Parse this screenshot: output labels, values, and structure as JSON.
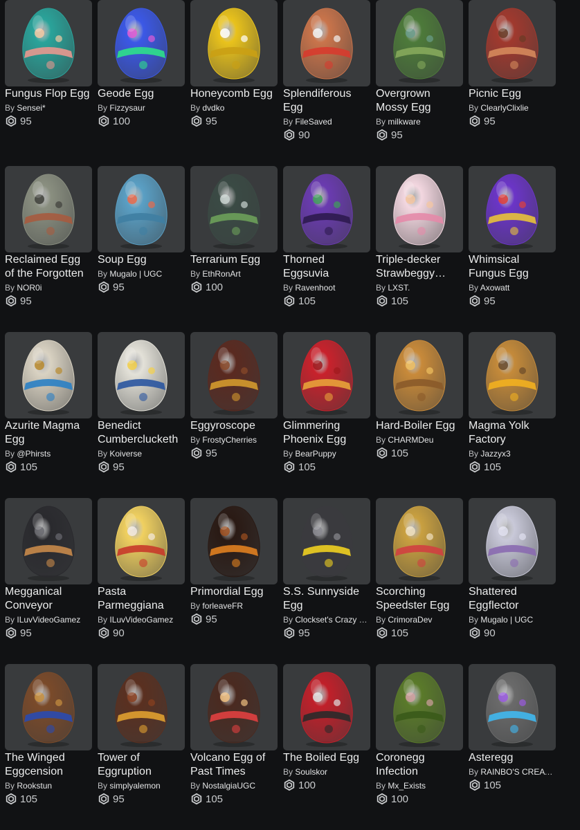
{
  "catalog": {
    "items": [
      {
        "name": "Fungus Flop Egg",
        "by": "By",
        "creator": "Sensei*",
        "price": "95",
        "icon": "mushroom-egg-icon"
      },
      {
        "name": "Geode Egg",
        "by": "By",
        "creator": "Fizzysaur",
        "price": "100",
        "icon": "crystal-egg-icon"
      },
      {
        "name": "Honeycomb Egg",
        "by": "By",
        "creator": "dvdko",
        "price": "95",
        "icon": "honeycomb-egg-icon"
      },
      {
        "name": "Splendiferous Egg",
        "by": "By",
        "creator": "FileSaved",
        "price": "90",
        "icon": "top-hat-egg-icon"
      },
      {
        "name": "Overgrown Mossy Egg",
        "by": "By",
        "creator": "milkware",
        "price": "95",
        "icon": "mossy-egg-icon"
      },
      {
        "name": "Picnic Egg",
        "by": "By",
        "creator": "ClearlyClixlie",
        "price": "95",
        "icon": "picnic-basket-egg-icon"
      },
      {
        "name": "Reclaimed Egg of the Forgotten",
        "by": "By",
        "creator": "NOR0i",
        "price": "95",
        "icon": "ruined-egg-icon"
      },
      {
        "name": "Soup Egg",
        "by": "By",
        "creator": "Mugalo | UGC",
        "price": "95",
        "icon": "soup-pot-egg-icon"
      },
      {
        "name": "Terrarium Egg",
        "by": "By",
        "creator": "EthRonArt",
        "price": "100",
        "icon": "terrarium-egg-icon"
      },
      {
        "name": "Thorned Eggsuvia",
        "by": "By",
        "creator": "Ravenhoot",
        "price": "105",
        "icon": "thorned-egg-icon"
      },
      {
        "name": "Triple-decker Strawbeggy Cake",
        "by": "By",
        "creator": "LXST.",
        "price": "105",
        "icon": "cake-egg-icon"
      },
      {
        "name": "Whimsical Fungus Egg",
        "by": "By",
        "creator": "Axowatt",
        "price": "95",
        "icon": "whimsical-mushroom-egg-icon"
      },
      {
        "name": "Azurite Magma Egg",
        "by": "By",
        "creator": "@Phirsts",
        "price": "105",
        "icon": "azurite-egg-icon"
      },
      {
        "name": "Benedict Cumberclucketh",
        "by": "By",
        "creator": "Koiverse",
        "price": "95",
        "icon": "mustache-egg-icon"
      },
      {
        "name": "Eggyroscope",
        "by": "By",
        "creator": "FrostyCherries",
        "price": "95",
        "icon": "gyroscope-egg-icon"
      },
      {
        "name": "Glimmering Phoenix Egg",
        "by": "By",
        "creator": "BearPuppy",
        "price": "105",
        "icon": "phoenix-egg-icon"
      },
      {
        "name": "Hard-Boiler Egg",
        "by": "By",
        "creator": "CHARMDeu",
        "price": "105",
        "icon": "boiler-egg-icon"
      },
      {
        "name": "Magma Yolk Factory",
        "by": "By",
        "creator": "Jazzyx3",
        "price": "105",
        "icon": "factory-egg-icon"
      },
      {
        "name": "Megganical Conveyor",
        "by": "By",
        "creator": "ILuvVideoGamez",
        "price": "95",
        "icon": "mechanical-egg-icon"
      },
      {
        "name": "Pasta Parmeggiana",
        "by": "By",
        "creator": "ILuvVideoGamez",
        "price": "90",
        "icon": "pasta-egg-icon"
      },
      {
        "name": "Primordial Egg",
        "by": "By",
        "creator": "forleaveFR",
        "price": "95",
        "icon": "primordial-egg-icon"
      },
      {
        "name": "S.S. Sunnyside Egg",
        "by": "By",
        "creator": "Clockset's Crazy Cre",
        "price": "95",
        "icon": "submarine-egg-icon"
      },
      {
        "name": "Scorching Speedster Egg",
        "by": "By",
        "creator": "CrimoraDev",
        "price": "105",
        "icon": "trophy-egg-icon"
      },
      {
        "name": "Shattered Eggflector",
        "by": "By",
        "creator": "Mugalo | UGC",
        "price": "90",
        "icon": "mirror-egg-icon"
      },
      {
        "name": "The Winged Eggcension",
        "by": "By",
        "creator": "Rookstun",
        "price": "105",
        "icon": "winged-egg-icon"
      },
      {
        "name": "Tower of Eggruption",
        "by": "By",
        "creator": "simplyalemon",
        "price": "95",
        "icon": "tower-egg-icon"
      },
      {
        "name": "Volcano Egg of Past Times",
        "by": "By",
        "creator": "NostalgiaUGC",
        "price": "105",
        "icon": "volcano-egg-icon"
      },
      {
        "name": "The Boiled Egg",
        "by": "By",
        "creator": "Soulskor",
        "price": "100",
        "icon": "boiled-egg-icon"
      },
      {
        "name": "Coronegg Infection",
        "by": "By",
        "creator": "Mx_Exists",
        "price": "100",
        "icon": "zombie-egg-icon"
      },
      {
        "name": "Asteregg",
        "by": "By",
        "creator": "RAINBO'S CREATIONS",
        "price": "105",
        "icon": "asteroid-egg-icon"
      }
    ]
  },
  "colors": {
    "background": "#111214",
    "tile": "#393b3d",
    "text": "#eceded",
    "muted": "#c9cbcd"
  },
  "icons": {
    "currency": "robux-icon"
  }
}
